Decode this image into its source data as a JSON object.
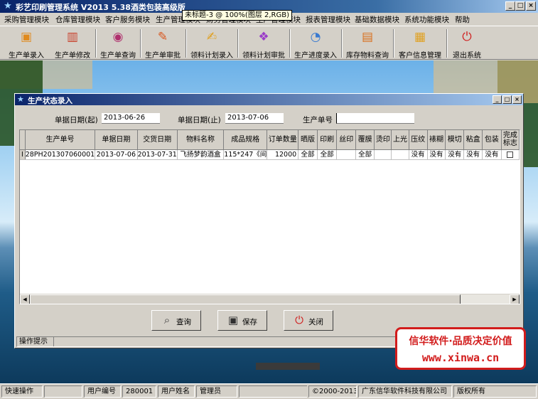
{
  "window": {
    "title": "彩艺印刷管理系统  V2013 5.38酒类包装高级版",
    "tooltip": "未标题-3 @ 100%(图层 2,RGB)",
    "controls": {
      "minimize": "_",
      "maximize": "□",
      "close": "×"
    }
  },
  "menu": [
    "采购管理模块",
    "仓库管理模块",
    "客户服务模块",
    "生产管理模块",
    "财务管理模块",
    "生产管理模块",
    "报表管理模块",
    "基础数据模块",
    "系统功能模块",
    "帮助"
  ],
  "toolbar": [
    {
      "label": "生产单录入",
      "icon": "package-icon"
    },
    {
      "label": "生产单修改",
      "icon": "edit-package-icon"
    },
    {
      "label": "生产单查询",
      "icon": "query-icon"
    },
    {
      "label": "生产单审批",
      "icon": "approve-icon"
    },
    {
      "label": "领料计划录入",
      "icon": "material-entry-icon"
    },
    {
      "label": "领料计划审批",
      "icon": "material-approve-icon"
    },
    {
      "label": "生产进度录入",
      "icon": "progress-icon"
    },
    {
      "label": "库存物料查询",
      "icon": "inventory-icon"
    },
    {
      "label": "客户信息管理",
      "icon": "customer-icon"
    },
    {
      "label": "退出系统",
      "icon": "power-icon"
    }
  ],
  "child_window": {
    "title": "生产状态录入",
    "filters": {
      "date_from_label": "单据日期(起)",
      "date_from": "2013-06-26",
      "date_to_label": "单据日期(止)",
      "date_to": "2013-07-06",
      "order_no_label": "生产单号",
      "order_no": ""
    },
    "columns": [
      "生产单号",
      "单据日期",
      "交货日期",
      "物料名称",
      "成品规格",
      "订单数量",
      "晒版",
      "印刷",
      "丝印",
      "覆膜",
      "烫印",
      "上光",
      "压纹",
      "裱糊",
      "模切",
      "粘盒",
      "包装",
      "完成标志"
    ],
    "rows": [
      {
        "order_no": "28PH201307060001",
        "doc_date": "2013-07-06",
        "delivery_date": "2013-07-31",
        "material": "飞扬梦韵酒盒",
        "spec": "115*247《间",
        "qty": "12000",
        "platemaking": "全部",
        "printing": "全部",
        "silkscreen": "",
        "laminating": "全部",
        "hot_stamp": "",
        "varnish": "",
        "embossing": "没有",
        "mounting": "没有",
        "die_cut": "没有",
        "gluing": "没有",
        "packing": "没有",
        "done": false
      }
    ],
    "row_marker": "I",
    "buttons": {
      "query": "查询",
      "save": "保存",
      "close": "关闭"
    },
    "hint": "操作提示"
  },
  "promo": {
    "line1": "信华软件·品质决定价值",
    "line2": "www.xinwa.cn"
  },
  "statusbar": {
    "quick_ops": "快速操作",
    "user_no_label": "用户编号",
    "user_no": "280001",
    "user_name_label": "用户姓名",
    "user_name": "管理员",
    "copyright": "©2000-2013?",
    "company": "广东信华软件科技有限公司",
    "rights": "版权所有"
  },
  "colors": {
    "title_bar": "#0a246a",
    "promo_red": "#d21c1c",
    "face": "#d4d0c8"
  }
}
